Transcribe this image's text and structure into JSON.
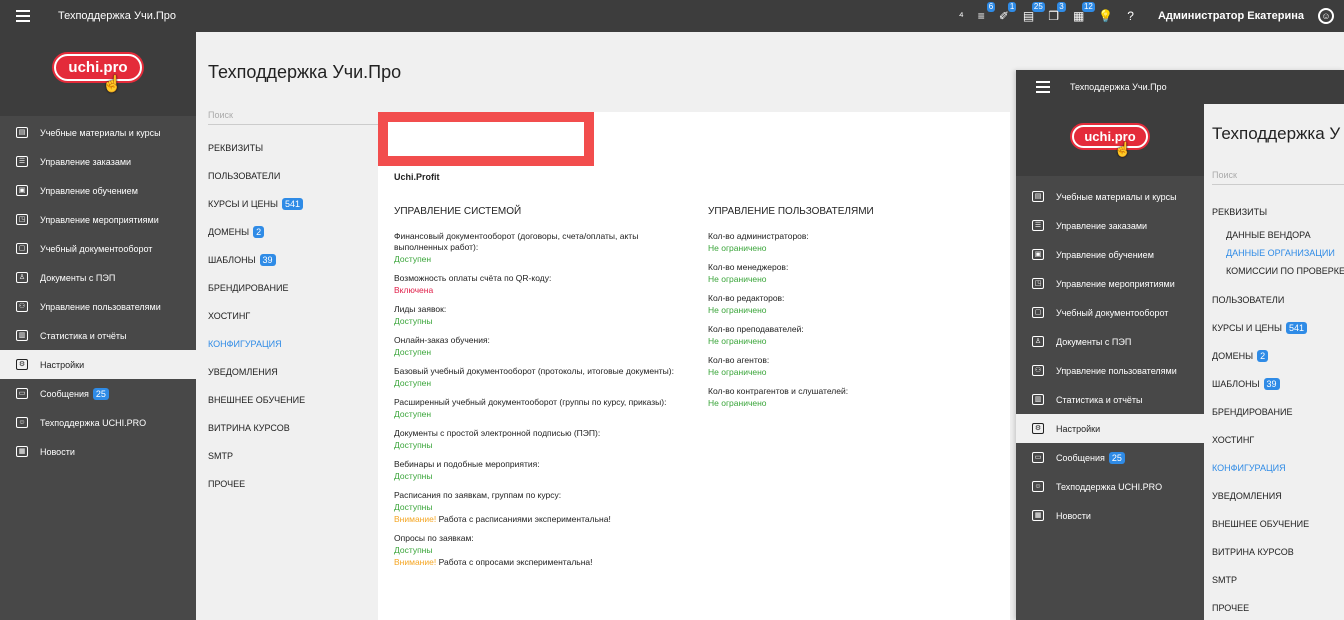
{
  "app": {
    "title": "Техподдержка Учи.Про",
    "user": "Администратор Екатерина"
  },
  "topbar_icons": [
    {
      "name": "users-add-icon",
      "glyph": "⁴",
      "count": ""
    },
    {
      "name": "list-icon",
      "glyph": "≡",
      "count": "6"
    },
    {
      "name": "pen-icon",
      "glyph": "✐",
      "count": "1"
    },
    {
      "name": "doc-list-icon",
      "glyph": "▤",
      "count": "25"
    },
    {
      "name": "copy-icon",
      "glyph": "❐",
      "count": "3"
    },
    {
      "name": "table-icon",
      "glyph": "▦",
      "count": "12"
    },
    {
      "name": "bulb-icon",
      "glyph": "💡",
      "count": ""
    },
    {
      "name": "help-icon",
      "glyph": "?",
      "count": ""
    }
  ],
  "logo": {
    "text": "uchi.pro"
  },
  "sidebar": [
    {
      "label": "Учебные материалы и курсы",
      "icon": "▤"
    },
    {
      "label": "Управление заказами",
      "icon": "☰"
    },
    {
      "label": "Управление обучением",
      "icon": "▣"
    },
    {
      "label": "Управление мероприятиями",
      "icon": "◳"
    },
    {
      "label": "Учебный документооборот",
      "icon": "▢"
    },
    {
      "label": "Документы с ПЭП",
      "icon": "♙"
    },
    {
      "label": "Управление пользователями",
      "icon": "⚇"
    },
    {
      "label": "Статистика и отчёты",
      "icon": "▥"
    },
    {
      "label": "Настройки",
      "icon": "⚙",
      "active": true
    },
    {
      "label": "Сообщения",
      "icon": "▭",
      "badge": "25"
    },
    {
      "label": "Техподдержка UCHI.PRO",
      "icon": "☺"
    },
    {
      "label": "Новости",
      "icon": "▦"
    }
  ],
  "page_title": "Техподдержка Учи.Про",
  "page_title_short": "Техподдержка У",
  "search_placeholder": "Поиск",
  "settings_menu": [
    {
      "label": "РЕКВИЗИТЫ"
    },
    {
      "label": "ПОЛЬЗОВАТЕЛИ"
    },
    {
      "label": "КУРСЫ И ЦЕНЫ",
      "badge": "541"
    },
    {
      "label": "ДОМЕНЫ",
      "badge": "2"
    },
    {
      "label": "ШАБЛОНЫ",
      "badge": "39"
    },
    {
      "label": "БРЕНДИРОВАНИЕ"
    },
    {
      "label": "ХОСТИНГ"
    },
    {
      "label": "КОНФИГУРАЦИЯ",
      "active": true
    },
    {
      "label": "УВЕДОМЛЕНИЯ"
    },
    {
      "label": "ВНЕШНЕЕ ОБУЧЕНИЕ"
    },
    {
      "label": "ВИТРИНА КУРСОВ"
    },
    {
      "label": "SMTP"
    },
    {
      "label": "ПРОЧЕЕ"
    }
  ],
  "rekvizity_submenu": [
    {
      "label": "ДАННЫЕ ВЕНДОРА"
    },
    {
      "label": "ДАННЫЕ ОРГАНИЗАЦИИ",
      "active": true
    },
    {
      "label": "КОМИССИИ ПО ПРОВЕРКЕ"
    }
  ],
  "config": {
    "tariff": "Uchi.Profit",
    "system_title": "УПРАВЛЕНИЕ СИСТЕМОЙ",
    "users_title": "УПРАВЛЕНИЕ ПОЛЬЗОВАТЕЛЯМИ",
    "system_items": [
      {
        "q": "Финансовый документооборот (договоры, счета/оплаты, акты выполненных работ):",
        "a": "Доступен"
      },
      {
        "q": "Возможность оплаты счёта по QR-коду:",
        "a": "Включена",
        "red": true
      },
      {
        "q": "Лиды заявок:",
        "a": "Доступны"
      },
      {
        "q": "Онлайн-заказ обучения:",
        "a": "Доступен"
      },
      {
        "q": "Базовый учебный документооборот (протоколы, итоговые документы):",
        "a": "Доступен"
      },
      {
        "q": "Расширенный учебный документооборот (группы по курсу, приказы):",
        "a": "Доступен"
      },
      {
        "q": "Документы с простой электронной подписью (ПЭП):",
        "a": "Доступны"
      },
      {
        "q": "Вебинары и подобные мероприятия:",
        "a": "Доступны"
      },
      {
        "q": "Расписания по заявкам, группам по курсу:",
        "a": "Доступны",
        "warn_label": "Внимание!",
        "warn": " Работа с расписаниями экспериментальна!"
      },
      {
        "q": "Опросы по заявкам:",
        "a": "Доступны",
        "warn_label": "Внимание!",
        "warn": " Работа с опросами экспериментальна!"
      }
    ],
    "user_items": [
      {
        "q": "Кол-во администраторов:",
        "a": "Не ограничено"
      },
      {
        "q": "Кол-во менеджеров:",
        "a": "Не ограничено"
      },
      {
        "q": "Кол-во редакторов:",
        "a": "Не ограничено"
      },
      {
        "q": "Кол-во преподавателей:",
        "a": "Не ограничено"
      },
      {
        "q": "Кол-во агентов:",
        "a": "Не ограничено"
      },
      {
        "q": "Кол-во контрагентов и слушателей:",
        "a": "Не ограничено"
      }
    ]
  }
}
